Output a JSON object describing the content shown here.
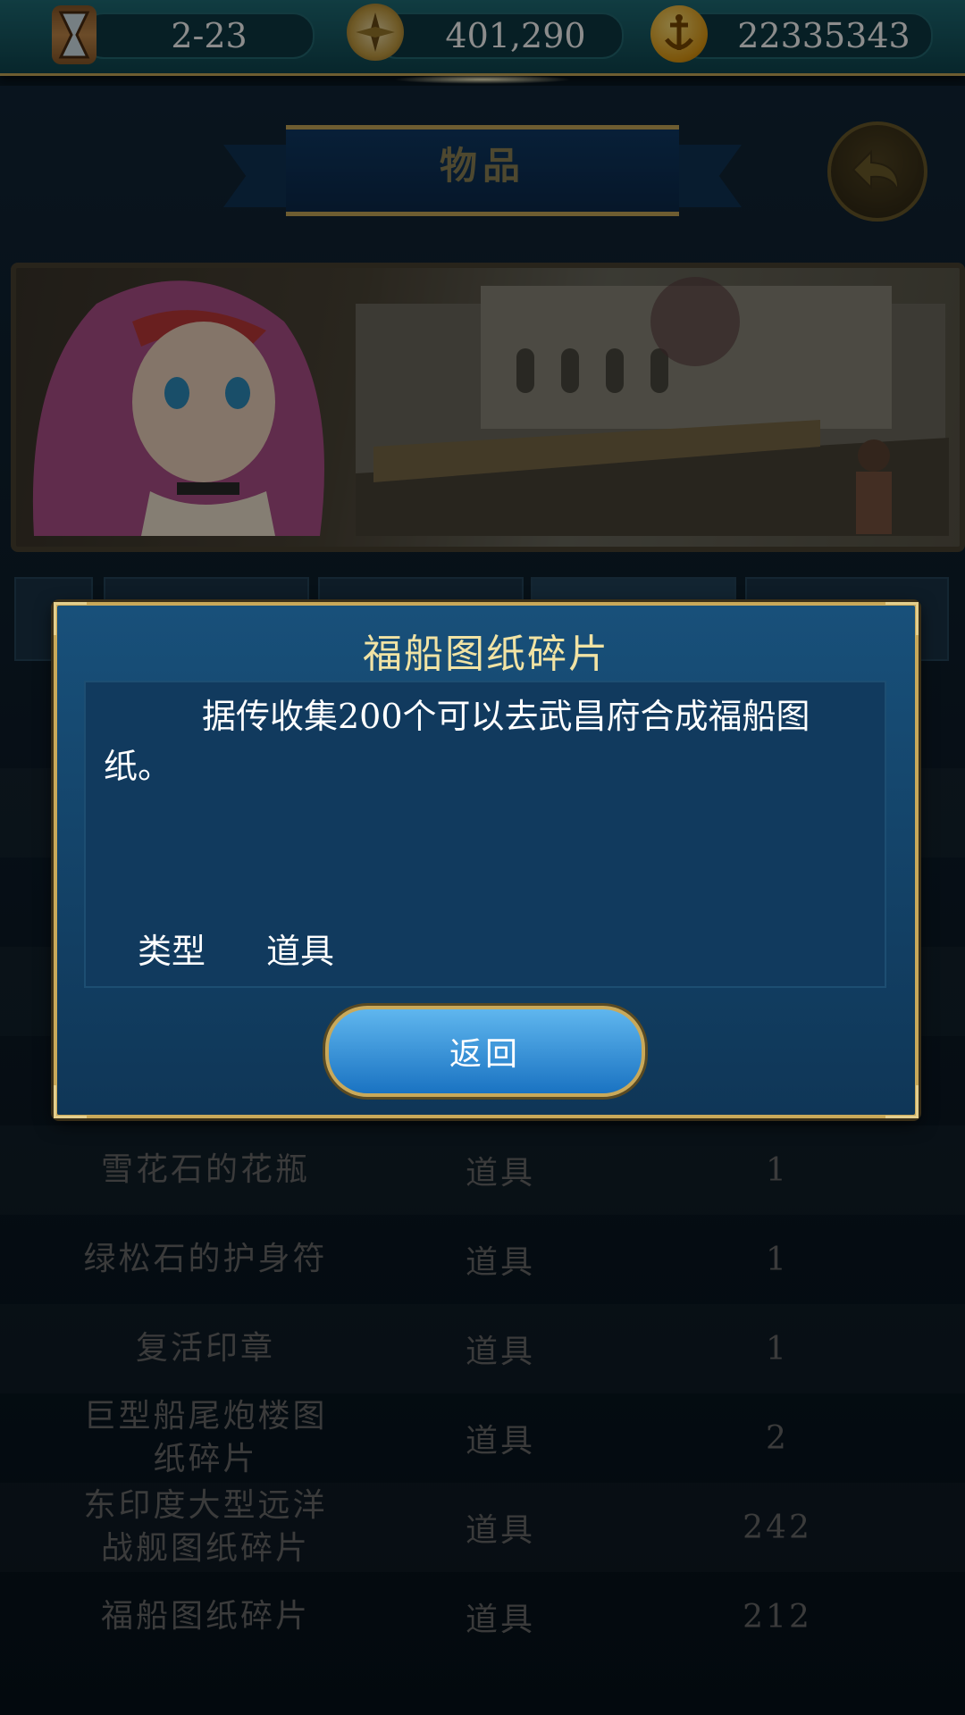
{
  "topbar": {
    "date": "2-23",
    "compass_value": "401,290",
    "gold_value": "22335343",
    "icons": [
      "hourglass-icon",
      "compass-icon",
      "gold-coin-anchor-icon"
    ]
  },
  "header": {
    "title": "物品"
  },
  "items": [
    {
      "name": "",
      "type": "",
      "count": ""
    },
    {
      "name": "",
      "type": "",
      "count": ""
    },
    {
      "name": "",
      "type": "",
      "count": ""
    },
    {
      "name": "",
      "type": "",
      "count": ""
    },
    {
      "name": "",
      "type": "",
      "count": ""
    },
    {
      "name": "雪花石的花瓶",
      "type": "道具",
      "count": "1"
    },
    {
      "name": "绿松石的护身符",
      "type": "道具",
      "count": "1"
    },
    {
      "name": "复活印章",
      "type": "道具",
      "count": "1"
    },
    {
      "name": "巨型船尾炮楼图纸碎片",
      "type": "道具",
      "count": "2"
    },
    {
      "name": "东印度大型远洋战舰图纸碎片",
      "type": "道具",
      "count": "242"
    },
    {
      "name": "福船图纸碎片",
      "type": "道具",
      "count": "212"
    }
  ],
  "modal": {
    "title": "福船图纸碎片",
    "description": "据传收集200个可以去武昌府合成福船图纸。",
    "type_label": "类型",
    "type_value": "道具",
    "return_button": "返回"
  },
  "colors": {
    "topbar": "#1f6e78",
    "gold": "#c9a95a",
    "modal_bg": "#18507a",
    "button": "#1a73c2"
  }
}
